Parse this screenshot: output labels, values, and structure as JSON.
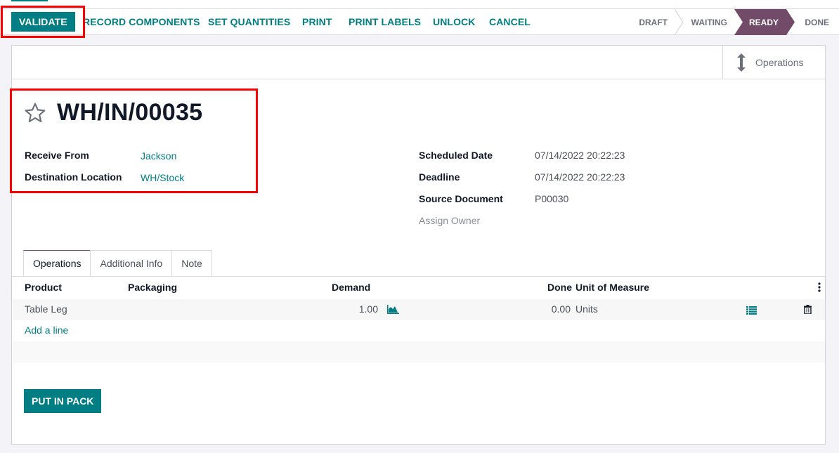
{
  "statusbar": {
    "validate_label": "VALIDATE",
    "actions": [
      "RECORD COMPONENTS",
      "SET QUANTITIES",
      "PRINT",
      "PRINT LABELS",
      "UNLOCK",
      "CANCEL"
    ],
    "stages": [
      "DRAFT",
      "WAITING",
      "READY",
      "DONE"
    ],
    "current_stage": "READY"
  },
  "smart_buttons": {
    "operations_label": "Operations",
    "operations_icon": "vertical-arrows-icon"
  },
  "record": {
    "favorite_icon": "star-outline-icon",
    "title": "WH/IN/00035",
    "left_fields": [
      {
        "label": "Receive From",
        "value": "Jackson"
      },
      {
        "label": "Destination Location",
        "value": "WH/Stock"
      }
    ],
    "right_fields": [
      {
        "label": "Scheduled Date",
        "value": "07/14/2022 20:22:23"
      },
      {
        "label": "Deadline",
        "value": "07/14/2022 20:22:23"
      },
      {
        "label": "Source Document",
        "value": "P00030"
      },
      {
        "label": "Assign Owner",
        "value": ""
      }
    ]
  },
  "tabs": [
    "Operations",
    "Additional Info",
    "Note"
  ],
  "active_tab": "Operations",
  "table": {
    "columns": [
      "Product",
      "Packaging",
      "Demand",
      "Done",
      "Unit of Measure"
    ],
    "rows": [
      {
        "product": "Table Leg",
        "packaging": "",
        "demand": "1.00",
        "done": "0.00",
        "uom": "Units"
      }
    ],
    "add_line_label": "Add a line"
  },
  "put_in_pack_label": "PUT IN PACK",
  "colors": {
    "primary": "#017e84",
    "stage_active": "#714b67",
    "annotation": "#ff0000"
  }
}
